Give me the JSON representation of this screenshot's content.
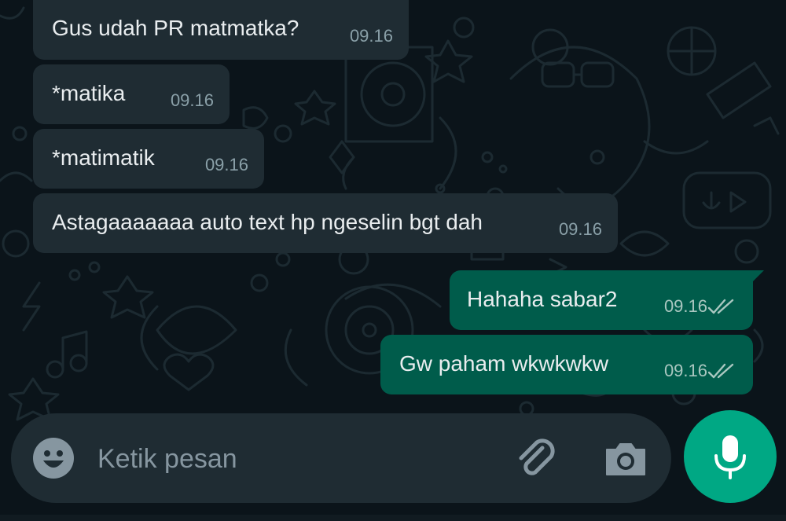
{
  "messages": [
    {
      "text": "Gus udah PR matmatka?",
      "time": "09.16",
      "direction": "incoming"
    },
    {
      "text": "*matika",
      "time": "09.16",
      "direction": "incoming"
    },
    {
      "text": "*matimatik",
      "time": "09.16",
      "direction": "incoming"
    },
    {
      "text": "Astagaaaaaaa auto text hp ngeselin bgt dah",
      "time": "09.16",
      "direction": "incoming"
    },
    {
      "text": "Hahaha sabar2",
      "time": "09.16",
      "direction": "outgoing",
      "status": "delivered"
    },
    {
      "text": "Gw paham wkwkwkw",
      "time": "09.16",
      "direction": "outgoing",
      "status": "delivered"
    }
  ],
  "composer": {
    "placeholder": "Ketik pesan",
    "emoji_icon": "emoji-icon",
    "attach_icon": "paperclip-icon",
    "camera_icon": "camera-icon",
    "mic_icon": "microphone-icon"
  },
  "colors": {
    "background": "#0b141a",
    "incoming_bubble": "#1f2c33",
    "outgoing_bubble": "#005c4b",
    "accent": "#00a884",
    "text": "#e9edef",
    "meta_text": "#8696a0"
  }
}
